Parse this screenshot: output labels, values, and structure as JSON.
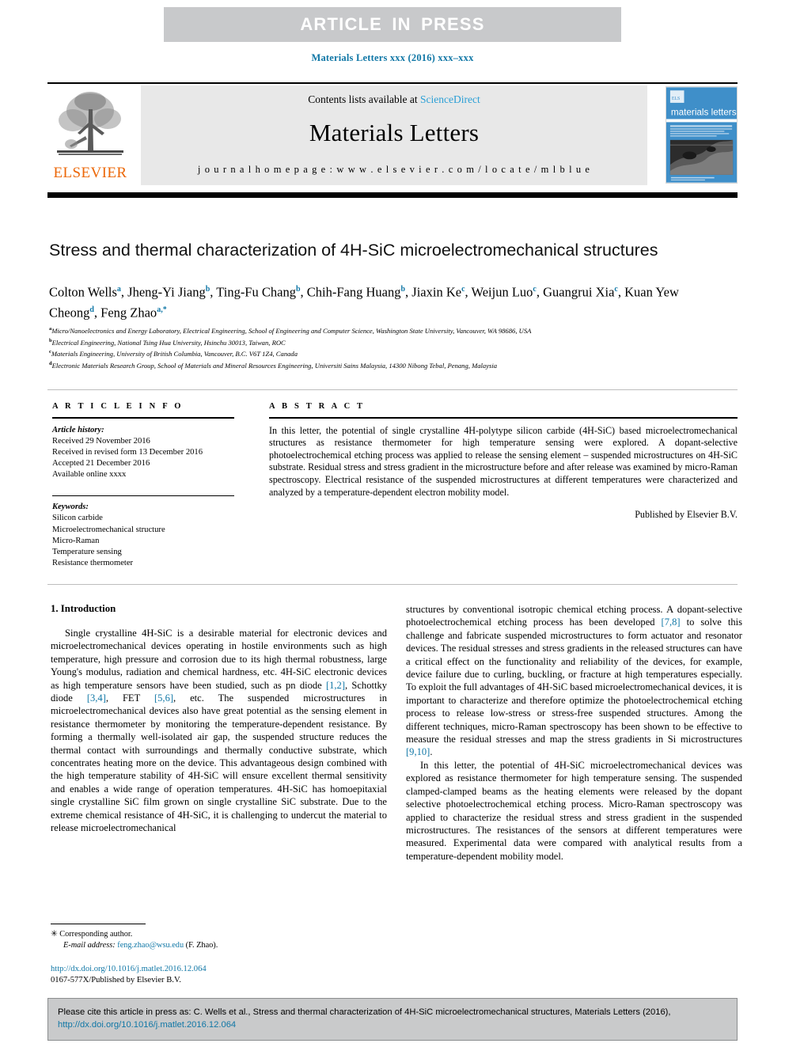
{
  "banner": {
    "text": "ARTICLE  IN  PRESS"
  },
  "running_head": "Materials Letters xxx (2016) xxx–xxx",
  "masthead": {
    "contents_prefix": "Contents lists available at ",
    "contents_link": "ScienceDirect",
    "journal_name": "Materials Letters",
    "homepage": "j o u r n a l   h o m e p a g e :   w w w . e l s e v i e r . c o m / l o c a t e / m l b l u e",
    "publisher_logo_word": "ELSEVIER",
    "cover_title": "materials letters"
  },
  "article": {
    "title": "Stress and thermal characterization of 4H-SiC microelectromechanical structures",
    "authors": [
      {
        "name": "Colton Wells",
        "sup": "a",
        "sep": ", "
      },
      {
        "name": "Jheng-Yi Jiang",
        "sup": "b",
        "sep": ", "
      },
      {
        "name": "Ting-Fu Chang",
        "sup": "b",
        "sep": ", "
      },
      {
        "name": "Chih-Fang Huang",
        "sup": "b",
        "sep": ", "
      },
      {
        "name": "Jiaxin Ke",
        "sup": "c",
        "sep": ", "
      },
      {
        "name": "Weijun Luo",
        "sup": "c",
        "sep": ", "
      },
      {
        "name": "Guangrui Xia",
        "sup": "c",
        "sep": ", "
      },
      {
        "name": "Kuan Yew Cheong",
        "sup": "d",
        "sep": ", "
      },
      {
        "name": "Feng Zhao",
        "sup": "a,*",
        "sep": ""
      }
    ],
    "affiliations": [
      {
        "mark": "a",
        "text": "Micro/Nanoelectronics and Energy Laboratory, Electrical Engineering, School of Engineering and Computer Science, Washington State University, Vancouver, WA 98686, USA"
      },
      {
        "mark": "b",
        "text": "Electrical Engineering, National Tsing Hua University, Hsinchu 30013, Taiwan, ROC"
      },
      {
        "mark": "c",
        "text": "Materials Engineering, University of British Columbia, Vancouver, B.C. V6T 1Z4, Canada"
      },
      {
        "mark": "d",
        "text": "Electronic Materials Research Group, School of Materials and Mineral Resources Engineering, Universiti Sains Malaysia, 14300 Nibong Tebal, Penang, Malaysia"
      }
    ]
  },
  "info": {
    "heading": "A R T I C L E   I N F O",
    "history_label": "Article history:",
    "history": [
      "Received 29 November 2016",
      "Received in revised form 13 December 2016",
      "Accepted 21 December 2016",
      "Available online xxxx"
    ],
    "keywords_label": "Keywords:",
    "keywords": [
      "Silicon carbide",
      "Microelectromechanical structure",
      "Micro-Raman",
      "Temperature sensing",
      "Resistance thermometer"
    ]
  },
  "abstract": {
    "heading": "A B S T R A C T",
    "text": "In this letter, the potential of single crystalline 4H-polytype silicon carbide (4H-SiC) based microelectromechanical structures as resistance thermometer for high temperature sensing were explored. A dopant-selective photoelectrochemical etching process was applied to release the sensing element – suspended microstructures on 4H-SiC substrate. Residual stress and stress gradient in the microstructure before and after release was examined by micro-Raman spectroscopy. Electrical resistance of the suspended microstructures at different temperatures were characterized and analyzed by a temperature-dependent electron mobility model.",
    "publisher": "Published by Elsevier B.V."
  },
  "body": {
    "section1_heading": "1. Introduction",
    "left_paragraph_1_a": "Single crystalline 4H-SiC is a desirable material for electronic devices and microelectromechanical devices operating in hostile environments such as high temperature, high pressure and corrosion due to its high thermal robustness, large Young's modulus, radiation and chemical hardness, etc. 4H-SiC electronic devices as high temperature sensors have been studied, such as pn diode ",
    "ref_1_2": "[1,2]",
    "left_paragraph_1_b": ", Schottky diode ",
    "ref_3_4": "[3,4]",
    "left_paragraph_1_c": ", FET ",
    "ref_5_6": "[5,6]",
    "left_paragraph_1_d": ", etc. The suspended microstructures in microelectromechanical devices also have great potential as the sensing element in resistance thermometer by monitoring the temperature-dependent resistance. By forming a thermally well-isolated air gap, the suspended structure reduces the thermal contact with surroundings and thermally conductive substrate, which concentrates heating more on the device. This advantageous design combined with the high temperature stability of 4H-SiC will ensure excellent thermal sensitivity and enables a wide range of operation temperatures. 4H-SiC has homoepitaxial single crystalline SiC film grown on single crystalline SiC substrate. Due to the extreme chemical resistance of 4H-SiC, it is challenging to undercut the material to release microelectromechanical",
    "right_paragraph_1_a": "structures by conventional isotropic chemical etching process. A dopant-selective photoelectrochemical etching process has been developed ",
    "ref_7_8": "[7,8]",
    "right_paragraph_1_b": " to solve this challenge and fabricate suspended microstructures to form actuator and resonator devices. The residual stresses and stress gradients in the released structures can have a critical effect on the functionality and reliability of the devices, for example, device failure due to curling, buckling, or fracture at high temperatures especially. To exploit the full advantages of 4H-SiC based microelectromechanical devices, it is important to characterize and therefore optimize the photoelectrochemical etching process to release low-stress or stress-free suspended structures. Among the different techniques, micro-Raman spectroscopy has been shown to be effective to measure the residual stresses and map the stress gradients in Si microstructures ",
    "ref_9_10": "[9,10]",
    "right_paragraph_1_c": ".",
    "right_paragraph_2": "In this letter, the potential of 4H-SiC microelectromechanical devices was explored as resistance thermometer for high temperature sensing. The suspended clamped-clamped beams as the heating elements were released by the dopant selective photoelectrochemical etching process. Micro-Raman spectroscopy was applied to characterize the residual stress and stress gradient in the suspended microstructures. The resistances of the sensors at different temperatures were measured. Experimental data were compared with analytical results from a temperature-dependent mobility model."
  },
  "footnote": {
    "marker": "✳",
    "corresponding": "Corresponding author.",
    "email_label": "E-mail address:",
    "email": "feng.zhao@wsu.edu",
    "email_suffix": " (F. Zhao).",
    "doi": "http://dx.doi.org/10.1016/j.matlet.2016.12.064",
    "issn_line": "0167-577X/Published by Elsevier B.V."
  },
  "citation_footer": {
    "text": "Please cite this article in press as: C. Wells et al., Stress and thermal characterization of 4H-SiC microelectromechanical structures, Materials Letters (2016),",
    "link": "http://dx.doi.org/10.1016/j.matlet.2016.12.064"
  },
  "colors": {
    "link": "#1077a6",
    "banner_bg": "#c8c9cb",
    "masthead_bg": "#e8e8e8",
    "elsevier_orange": "#ec6707",
    "cover_blue": "#2b7bbd"
  }
}
